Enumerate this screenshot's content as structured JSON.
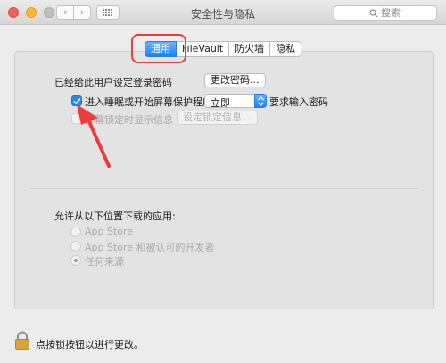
{
  "window": {
    "title": "安全性与隐私",
    "search_placeholder": "搜索",
    "nav_back": "‹",
    "nav_forward": "›"
  },
  "tabs": [
    {
      "label": "通用",
      "active": true
    },
    {
      "label": "FileVault",
      "active": false
    },
    {
      "label": "防火墙",
      "active": false
    },
    {
      "label": "隐私",
      "active": false
    }
  ],
  "general": {
    "password_set_label": "已经给此用户设定登录密码",
    "change_password_button": "更改密码...",
    "require_password": {
      "checked": true,
      "label": "进入睡眠或开始屏幕保护程序",
      "select_value": "立即",
      "suffix": "要求输入密码"
    },
    "lock_message": {
      "checked": false,
      "enabled": false,
      "label": "屏幕锁定时显示信息",
      "button": "设定锁定信息..."
    }
  },
  "downloads": {
    "heading": "允许从以下位置下载的应用:",
    "options": [
      {
        "label": "App Store",
        "selected": false
      },
      {
        "label": "App Store 和被认可的开发者",
        "selected": false
      },
      {
        "label": "任何来源",
        "selected": true
      }
    ]
  },
  "footer": {
    "lock_text": "点按锁按钮以进行更改。"
  },
  "colors": {
    "accent": "#1a82fb",
    "annotation": "#ee3b3b"
  }
}
